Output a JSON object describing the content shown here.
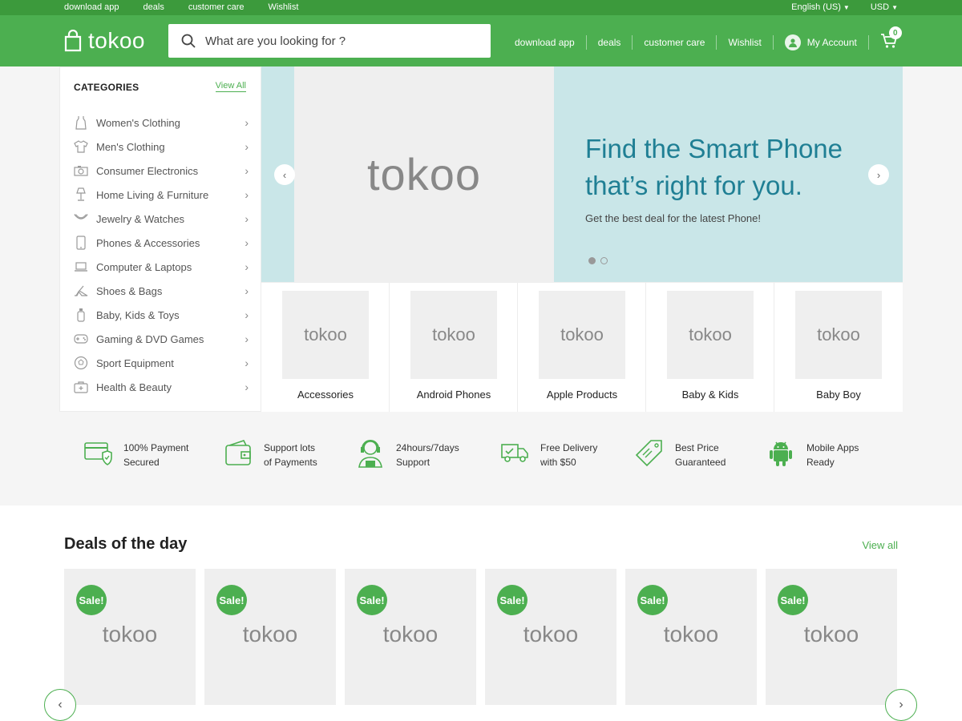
{
  "topbar": {
    "links": [
      "download app",
      "deals",
      "customer care",
      "Wishlist"
    ],
    "language": "English (US)",
    "currency": "USD"
  },
  "header": {
    "logo": "tokoo",
    "search_placeholder": "What are you looking for ?",
    "nav": [
      "download app",
      "deals",
      "customer care",
      "Wishlist"
    ],
    "account": "My Account",
    "cart_count": "0"
  },
  "categories": {
    "title": "CATEGORIES",
    "view_all": "View All",
    "items": [
      {
        "label": "Women's Clothing",
        "icon": "dress-icon"
      },
      {
        "label": "Men's Clothing",
        "icon": "shirt-icon"
      },
      {
        "label": "Consumer Electronics",
        "icon": "camera-icon"
      },
      {
        "label": "Home Living & Furniture",
        "icon": "lamp-icon"
      },
      {
        "label": "Jewelry & Watches",
        "icon": "necklace-icon"
      },
      {
        "label": "Phones & Accessories",
        "icon": "phone-icon"
      },
      {
        "label": "Computer & Laptops",
        "icon": "laptop-icon"
      },
      {
        "label": "Shoes & Bags",
        "icon": "heel-icon"
      },
      {
        "label": "Baby, Kids & Toys",
        "icon": "bottle-icon"
      },
      {
        "label": "Gaming & DVD Games",
        "icon": "gamepad-icon"
      },
      {
        "label": "Sport Equipment",
        "icon": "ball-icon"
      },
      {
        "label": "Health & Beauty",
        "icon": "firstaid-icon"
      }
    ]
  },
  "hero": {
    "image_text": "tokoo",
    "title_line1": "Find the Smart Phone",
    "title_line2": "that’s right for you.",
    "subtitle": "Get the best deal for the latest Phone!",
    "slide_index": 1,
    "slide_count": 2
  },
  "tiles": [
    {
      "image_text": "tokoo",
      "name": "Accessories"
    },
    {
      "image_text": "tokoo",
      "name": "Android Phones"
    },
    {
      "image_text": "tokoo",
      "name": "Apple Products"
    },
    {
      "image_text": "tokoo",
      "name": "Baby & Kids"
    },
    {
      "image_text": "tokoo",
      "name": "Baby Boy"
    }
  ],
  "features": [
    {
      "line1": "100% Payment",
      "line2": "Secured",
      "icon": "card-shield-icon"
    },
    {
      "line1": "Support lots",
      "line2": "of Payments",
      "icon": "wallet-icon"
    },
    {
      "line1": "24hours/7days",
      "line2": "Support",
      "icon": "support-agent-icon"
    },
    {
      "line1": "Free Delivery",
      "line2": "with $50",
      "icon": "truck-icon"
    },
    {
      "line1": "Best Price",
      "line2": "Guaranteed",
      "icon": "price-tag-icon"
    },
    {
      "line1": "Mobile Apps",
      "line2": "Ready",
      "icon": "android-icon"
    }
  ],
  "deals": {
    "title": "Deals of the day",
    "view_all": "View all",
    "items": [
      {
        "badge": "Sale!",
        "image_text": "tokoo"
      },
      {
        "badge": "Sale!",
        "image_text": "tokoo"
      },
      {
        "badge": "Sale!",
        "image_text": "tokoo"
      },
      {
        "badge": "Sale!",
        "image_text": "tokoo"
      },
      {
        "badge": "Sale!",
        "image_text": "tokoo"
      },
      {
        "badge": "Sale!",
        "image_text": "tokoo"
      }
    ]
  },
  "colors": {
    "brand_green": "#4caf50",
    "topbar_green": "#3c9a3c",
    "hero_bg": "#c9e6e8",
    "hero_title": "#1f7f94"
  }
}
